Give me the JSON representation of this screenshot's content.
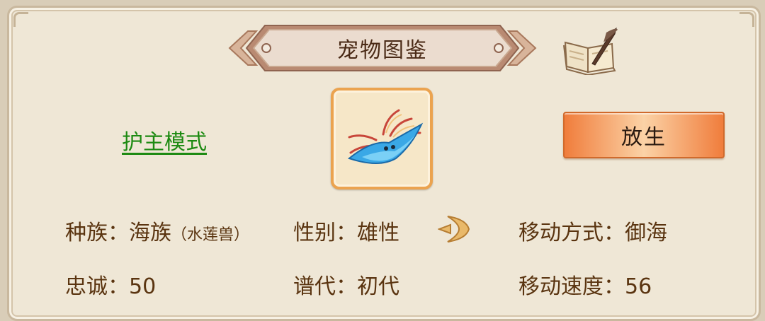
{
  "header": {
    "title": "宠物图鉴",
    "book_icon": "book-quill-icon"
  },
  "mode_link": {
    "label": "护主模式"
  },
  "pet": {
    "portrait_icon": "manta-ray-pet-icon"
  },
  "release_button": {
    "label": "放生"
  },
  "stats": {
    "race_label": "种族：",
    "race_value": "海族",
    "race_sub_open": "（",
    "race_sub": "水莲兽",
    "race_sub_close": "）",
    "gender_label": "性别：",
    "gender_value": "雄性",
    "move_type_label": "移动方式：",
    "move_type_value": "御海",
    "loyalty_label": "忠诚：",
    "loyalty_value": "50",
    "lineage_label": "谱代：",
    "lineage_value": "初代",
    "move_speed_label": "移动速度：",
    "move_speed_value": "56"
  },
  "colors": {
    "accent_orange": "#f07d3c",
    "link_green": "#1d8a12",
    "text_brown": "#5a3410"
  }
}
